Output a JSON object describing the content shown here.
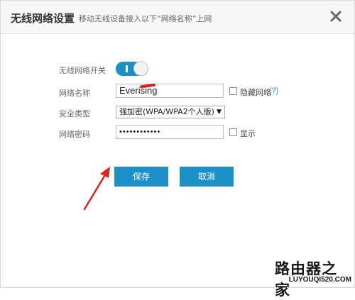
{
  "dialog": {
    "title": "无线网络设置",
    "subtitle": "移动无线设备接入以下“网络名称”上网",
    "close_icon": "close-icon"
  },
  "form": {
    "wifi_toggle": {
      "label": "无线网络开关",
      "state": "on"
    },
    "network_name": {
      "label": "网络名称",
      "value": "Everising",
      "hide_label": "隐藏网络",
      "help": "(?)"
    },
    "security_type": {
      "label": "安全类型",
      "value": "强加密(WPA/WPA2个人版)"
    },
    "password": {
      "label": "网络密码",
      "value": "••••••••••••",
      "show_label": "显示"
    }
  },
  "buttons": {
    "save": "保存",
    "cancel": "取消"
  },
  "watermark": {
    "main": "路由器之家",
    "sub": "LUYOUQI520.COM"
  },
  "colors": {
    "accent": "#1e90c8",
    "annotation": "#e02020"
  }
}
